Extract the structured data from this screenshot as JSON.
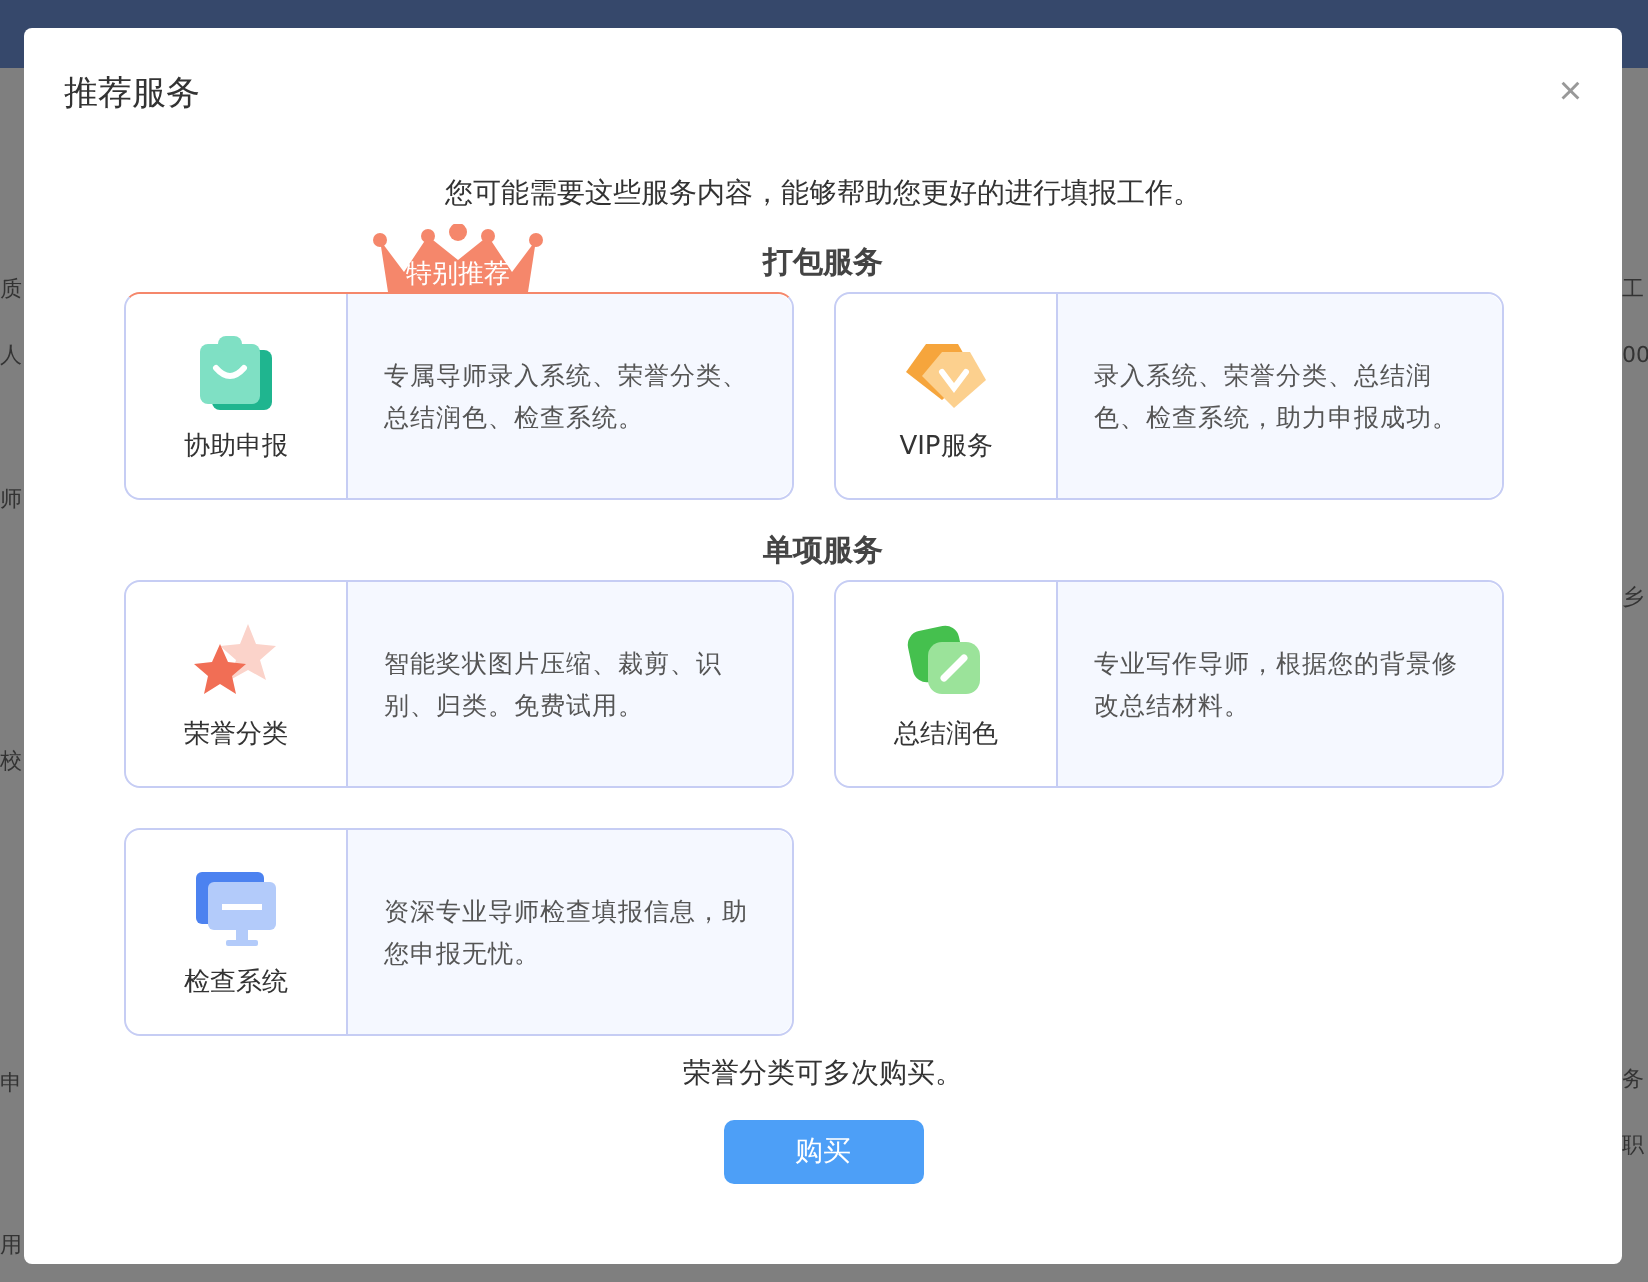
{
  "background": {
    "left_labels": [
      "质",
      "人",
      "师",
      "校",
      "申",
      "用"
    ],
    "right_labels": [
      "工",
      "00",
      "乡",
      "务",
      "职"
    ]
  },
  "dialog": {
    "title": "推荐服务",
    "close": "×",
    "intro": "您可能需要这些服务内容，能够帮助您更好的进行填报工作。",
    "sections": [
      {
        "title": "打包服务",
        "services": [
          {
            "name": "协助申报",
            "kind": "bag",
            "description": "专属导师录入系统、荣誉分类、总结润色、检查系统。",
            "featured": true,
            "badge": "特别推荐"
          },
          {
            "name": "VIP服务",
            "kind": "diamond",
            "description": "录入系统、荣誉分类、总结润色、检查系统，助力申报成功。",
            "featured": false
          }
        ]
      },
      {
        "title": "单项服务",
        "services": [
          {
            "name": "荣誉分类",
            "kind": "stars",
            "description": "智能奖状图片压缩、裁剪、识别、归类。免费试用。",
            "featured": false
          },
          {
            "name": "总结润色",
            "kind": "pen",
            "description": "专业写作导师，根据您的背景修改总结材料。",
            "featured": false
          },
          {
            "name": "检查系统",
            "kind": "monitor",
            "description": "资深专业导师检查填报信息，助您申报无忧。",
            "featured": false
          }
        ]
      }
    ],
    "note": "荣誉分类可多次购买。",
    "button": "购买"
  }
}
